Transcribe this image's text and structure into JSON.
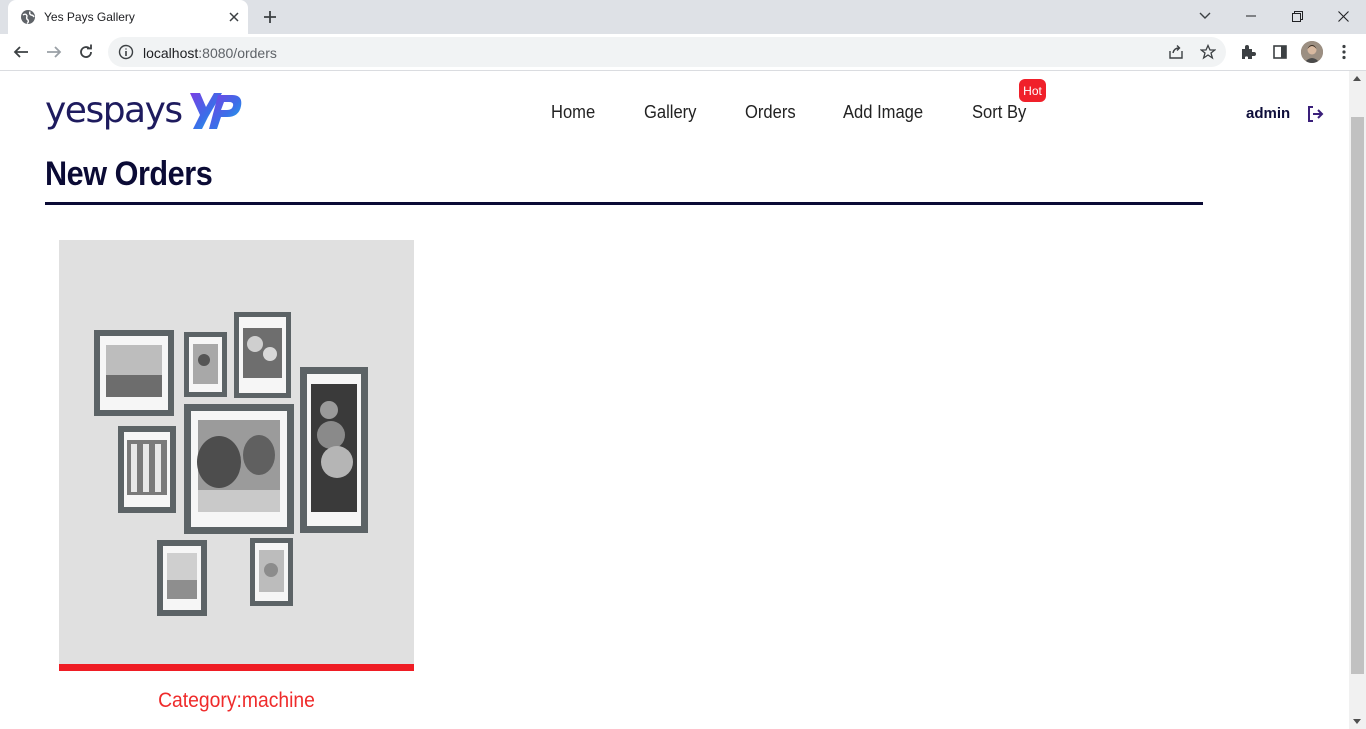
{
  "browser": {
    "tab_title": "Yes Pays Gallery",
    "url_host": "localhost",
    "url_path": ":8080/orders"
  },
  "header": {
    "logo_text": "yespays",
    "nav": [
      {
        "label": "Home"
      },
      {
        "label": "Gallery"
      },
      {
        "label": "Orders"
      },
      {
        "label": "Add Image"
      },
      {
        "label": "Sort By"
      }
    ],
    "hot_badge": "Hot",
    "user": "admin"
  },
  "main": {
    "title": "New Orders",
    "orders": [
      {
        "category_label": "Category:",
        "category_value": "machine"
      }
    ]
  },
  "colors": {
    "brand_navy": "#1e1b5e",
    "accent_red": "#ef1d24",
    "logo_gradient_start": "#7b3fe4",
    "logo_gradient_end": "#17b6e8"
  }
}
